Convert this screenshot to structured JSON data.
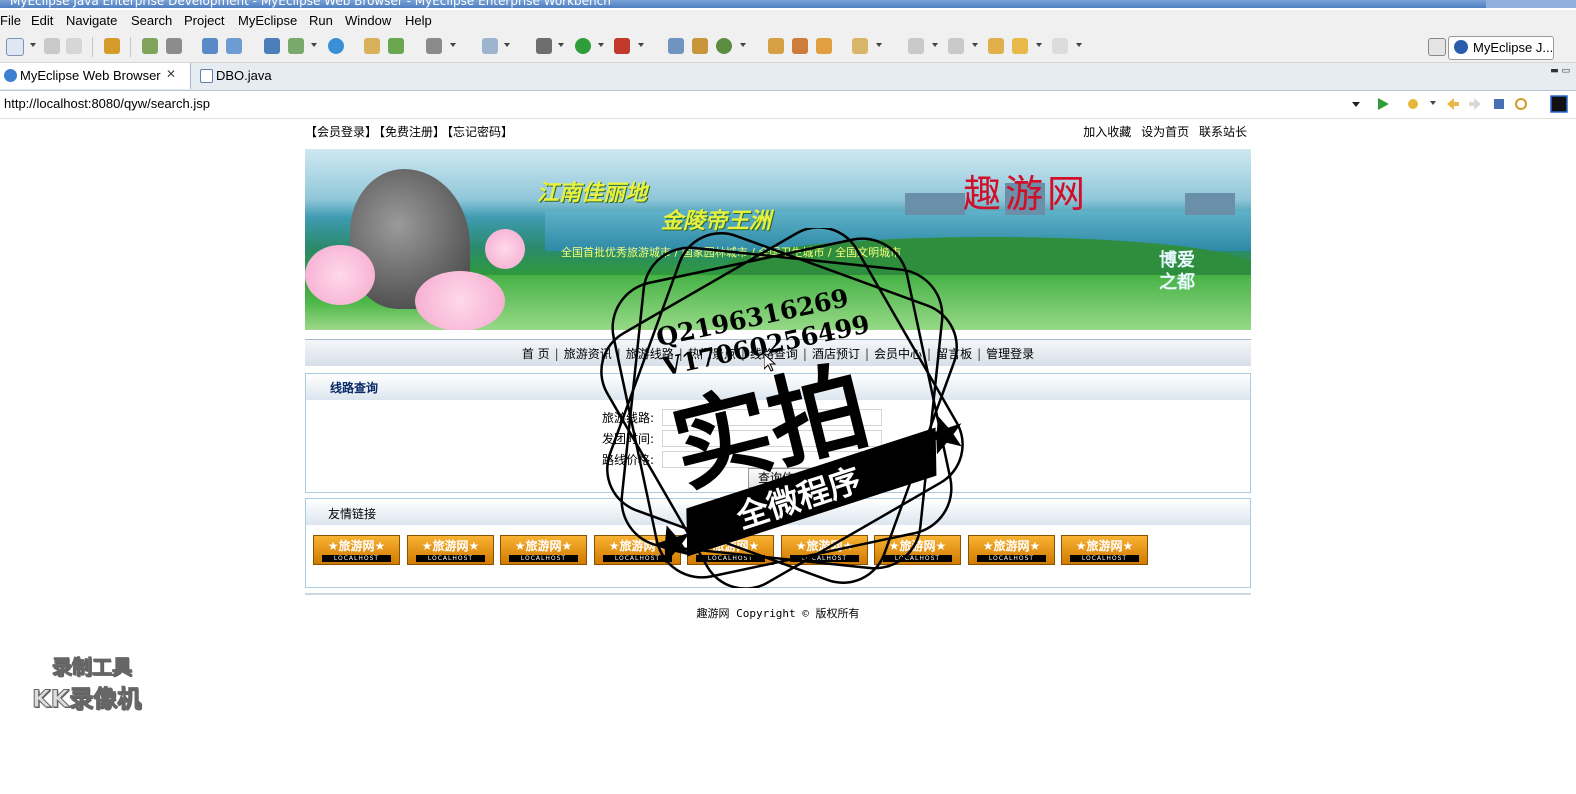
{
  "window": {
    "title": "MyEclipse Java Enterprise Development - MyEclipse Web Browser - MyEclipse Enterprise Workbench"
  },
  "menu": [
    "File",
    "Edit",
    "Navigate",
    "Search",
    "Project",
    "MyEclipse",
    "Run",
    "Window",
    "Help"
  ],
  "perspective": {
    "label": "MyEclipse J..."
  },
  "tabs": [
    {
      "label": "MyEclipse Web Browser",
      "active": true,
      "close": "✕"
    },
    {
      "label": "DBO.java",
      "active": false
    }
  ],
  "browser": {
    "url": "http://localhost:8080/qyw/search.jsp"
  },
  "site": {
    "top_links": [
      "【会员登录】",
      "【免费注册】",
      "【忘记密码】"
    ],
    "right_links": [
      "加入收藏",
      "设为首页",
      "联系站长"
    ],
    "banner": {
      "line1": "江南佳丽地",
      "line2": "金陵帝王洲",
      "slogan": "全国首批优秀旅游城市 / 国家园林城市 / 全国卫生城市 / 全国文明城市",
      "brand": "趣游网",
      "side": "博爱之都"
    },
    "nav": [
      "首 页",
      "旅游资讯",
      "旅游线路",
      "热门景点",
      "线路查询",
      "酒店预订",
      "会员中心",
      "留言板",
      "管理登录"
    ],
    "search": {
      "title": "线路查询",
      "fields": [
        {
          "label": "旅游线路:",
          "value": ""
        },
        {
          "label": "发团时间:",
          "value": ""
        },
        {
          "label": "路线价格:",
          "value": ""
        }
      ],
      "button": "查询信息"
    },
    "friends": {
      "title": "友情链接",
      "link_text": "★旅游网★",
      "link_sub": "LOCALHOST",
      "count": 9
    },
    "footer": "趣游网 Copyright © 版权所有"
  },
  "overlay": {
    "watermark_qq": "Q2196316269",
    "watermark_v": "V17060256499",
    "watermark_big": "实拍",
    "watermark_ribbon": "全微程序",
    "recorder_line1": "录制工具",
    "recorder_line2": "KK录像机"
  },
  "colors": {
    "brand_red": "#d0102a",
    "link_orange": "#f9b233",
    "box_border": "#aacbe0"
  }
}
